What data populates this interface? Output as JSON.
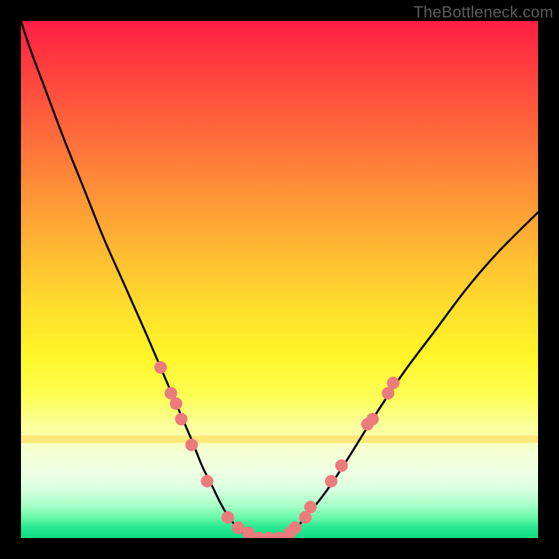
{
  "watermark": {
    "text": "TheBottleneck.com"
  },
  "chart_data": {
    "type": "line",
    "title": "",
    "xlabel": "",
    "ylabel": "",
    "x_range": [
      0,
      100
    ],
    "y_range": [
      0,
      100
    ],
    "grid": false,
    "legend": false,
    "background": {
      "kind": "vertical-gradient",
      "stops": [
        {
          "pos": 0.0,
          "color": "#ff1e44"
        },
        {
          "pos": 0.3,
          "color": "#ff7a3a"
        },
        {
          "pos": 0.55,
          "color": "#ffc333"
        },
        {
          "pos": 0.75,
          "color": "#fff22a"
        },
        {
          "pos": 0.82,
          "color": "#faff9f"
        },
        {
          "pos": 0.9,
          "color": "#c3ffcf"
        },
        {
          "pos": 1.0,
          "color": "#0fdd82"
        }
      ]
    },
    "series": [
      {
        "name": "main-curve",
        "color": "#000000",
        "stroke_width": 3,
        "x": [
          0,
          2,
          5,
          8,
          12,
          16,
          20,
          24,
          27,
          30,
          33,
          35,
          37,
          39,
          41,
          43,
          45,
          48,
          52,
          55,
          59,
          63,
          68,
          74,
          80,
          86,
          92,
          100
        ],
        "y": [
          100,
          94,
          86,
          78,
          68,
          58,
          49,
          40,
          33,
          26,
          19,
          14,
          10,
          6,
          3,
          1,
          0,
          0,
          1,
          4,
          9,
          15,
          23,
          32,
          40,
          48,
          55,
          63
        ]
      }
    ],
    "markers": {
      "color": "#ec7b7d",
      "radius": 9,
      "points": [
        {
          "x": 27,
          "y": 33
        },
        {
          "x": 29,
          "y": 28
        },
        {
          "x": 30,
          "y": 26
        },
        {
          "x": 31,
          "y": 23
        },
        {
          "x": 33,
          "y": 18
        },
        {
          "x": 36,
          "y": 11
        },
        {
          "x": 40,
          "y": 4
        },
        {
          "x": 42,
          "y": 2
        },
        {
          "x": 44,
          "y": 1
        },
        {
          "x": 46,
          "y": 0
        },
        {
          "x": 48,
          "y": 0
        },
        {
          "x": 50,
          "y": 0
        },
        {
          "x": 52,
          "y": 1
        },
        {
          "x": 53,
          "y": 2
        },
        {
          "x": 55,
          "y": 4
        },
        {
          "x": 56,
          "y": 6
        },
        {
          "x": 60,
          "y": 11
        },
        {
          "x": 62,
          "y": 14
        },
        {
          "x": 67,
          "y": 22
        },
        {
          "x": 68,
          "y": 23
        },
        {
          "x": 71,
          "y": 28
        },
        {
          "x": 72,
          "y": 30
        }
      ]
    }
  }
}
